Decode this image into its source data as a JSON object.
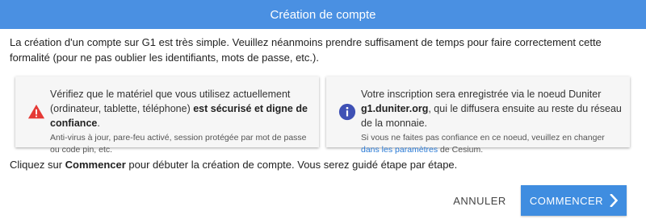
{
  "header": {
    "title": "Création de compte"
  },
  "intro": {
    "text": "La création d'un compte sur G1 est très simple. Veuillez néanmoins prendre suffisament de temps pour faire correctement cette formalité (pour ne pas oublier les identifiants, mots de passe, etc.)."
  },
  "warning_card": {
    "icon": "warning-icon",
    "icon_color": "#e53935",
    "text_prefix": "Vérifiez que le matériel que vous utilisez actuellement (ordinateur, tablette, téléphone) ",
    "text_bold": "est sécurisé et digne de confiance",
    "text_suffix": ".",
    "small": "Anti-virus à jour, pare-feu activé, session protégée par mot de passe ou code pin, etc."
  },
  "info_card": {
    "icon": "info-icon",
    "icon_color": "#3f51b5",
    "text_prefix": "Votre inscription sera enregistrée via le noeud Duniter ",
    "text_bold": "g1.duniter.org",
    "text_suffix": ", qui le diffusera ensuite au reste du réseau de la monnaie.",
    "small_prefix": "Si vous ne faites pas confiance en ce noeud, veuillez en changer ",
    "small_link": "dans les paramètres",
    "small_suffix": " de Cesium."
  },
  "outro": {
    "prefix": "Cliquez sur ",
    "bold": "Commencer",
    "suffix": " pour débuter la création de compte. Vous serez guidé étape par étape."
  },
  "buttons": {
    "cancel_label": "ANNULER",
    "start_label": "COMMENCER"
  },
  "colors": {
    "header_bg": "#4a90e2",
    "primary_button": "#3f8de0",
    "link": "#2b7bd6"
  }
}
